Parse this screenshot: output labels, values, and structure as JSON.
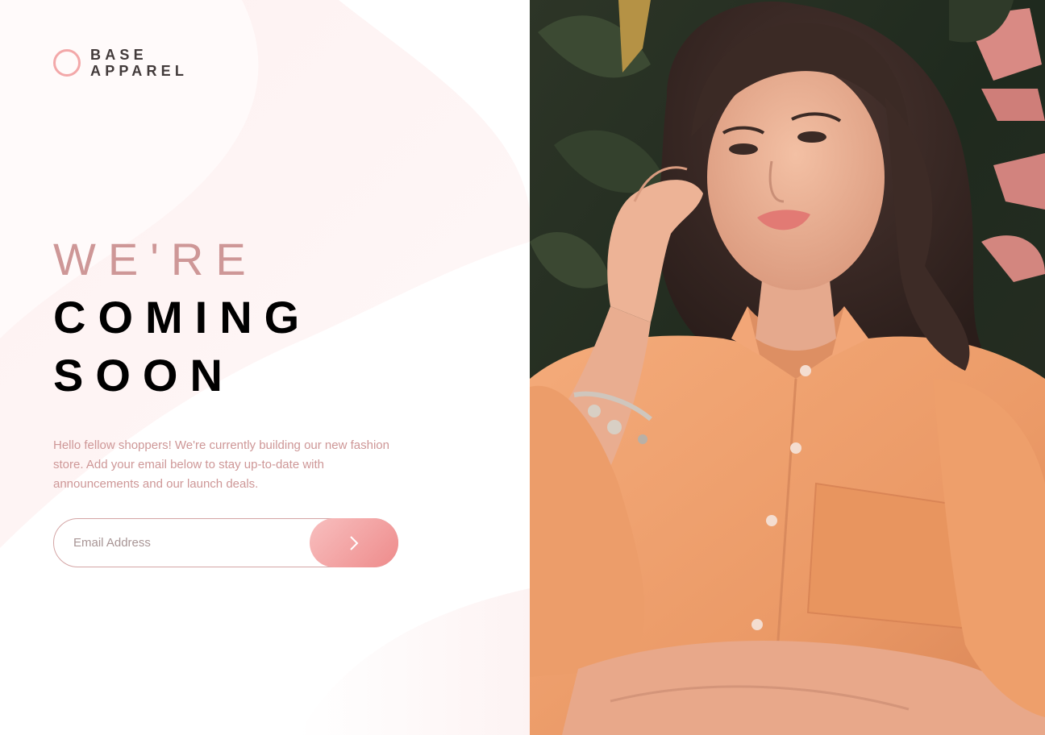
{
  "brand": {
    "line1": "BASE",
    "line2": "APPAREL",
    "accent_color": "#f3a8a9"
  },
  "hero": {
    "headline_line1": "WE'RE",
    "headline_line2": "COMING",
    "headline_line3": "SOON",
    "intro": "Hello fellow shoppers! We're currently building our new fashion store. Add your email below to stay up-to-date with announcements and our launch deals."
  },
  "signup": {
    "email_placeholder": "Email Address",
    "submit_icon": "chevron-right-icon"
  },
  "colors": {
    "desaturated_red": "#ce9797",
    "dark_grayish_red": "#423a3a",
    "button_gradient_start": "#f8bfbf",
    "button_gradient_end": "#ee8b8b",
    "shirt_orange": "#f0a070"
  }
}
